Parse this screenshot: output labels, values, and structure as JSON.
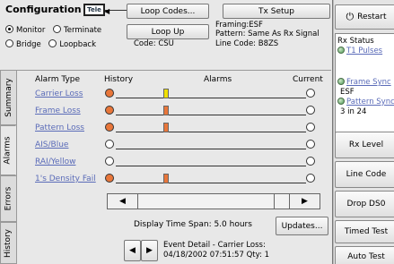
{
  "header": {
    "title": "Configuration",
    "tele_icon_label": "Tele",
    "loop_codes_button": "Loop Codes...",
    "tx_setup_button": "Tx Setup",
    "loop_up_button": "Loop Up"
  },
  "mode": {
    "monitor": "Monitor",
    "terminate": "Terminate",
    "bridge": "Bridge",
    "loopback": "Loopback",
    "selected": "Monitor"
  },
  "line_info": {
    "code": "Code: CSU",
    "framing": "Framing:ESF",
    "pattern": "Pattern: Same As Rx Signal",
    "line_code": "Line Code: B8ZS"
  },
  "tabs": [
    "Summary",
    "Alarms",
    "Errors",
    "History"
  ],
  "active_tab": "Alarms",
  "alarms": {
    "col_type": "Alarm Type",
    "col_history": "History",
    "col_alarms": "Alarms",
    "col_current": "Current",
    "rows": [
      {
        "name": "Carrier Loss",
        "history_color": "#e8763a",
        "bar_color": "#f0e000",
        "current": "off"
      },
      {
        "name": "Frame Loss",
        "history_color": "#e8763a",
        "bar_color": "#e8763a",
        "current": "off"
      },
      {
        "name": "Pattern Loss",
        "history_color": "#e8763a",
        "bar_color": "#e8763a",
        "current": "off"
      },
      {
        "name": "AIS/Blue",
        "history_color": "#ffffff",
        "bar_color": null,
        "current": "off"
      },
      {
        "name": "RAI/Yellow",
        "history_color": "#ffffff",
        "bar_color": null,
        "current": "off"
      },
      {
        "name": "1's Density Fail",
        "history_color": "#e8763a",
        "bar_color": "#e8763a",
        "current": "off"
      }
    ]
  },
  "time_span": "Display Time Span: 5.0 hours",
  "updates_button": "Updates...",
  "event_detail": {
    "line1": "Event Detail - Carrier Loss:",
    "line2": "04/18/2002  07:51:57 Qty: 1"
  },
  "sidebar": {
    "restart": "Restart",
    "rx_status_title": "Rx Status",
    "t1_pulses": "T1 Pulses",
    "frame_sync": "Frame Sync",
    "esf": "ESF",
    "pattern_sync": "Pattern Sync",
    "pattern_value": "3 in 24",
    "rx_level": "Rx Level",
    "line_code": "Line Code",
    "drop_ds0": "Drop DS0",
    "timed_test": "Timed Test",
    "auto_test": "Auto Test"
  },
  "colors": {
    "accent_link": "#5a6bb8",
    "history_orange": "#e8763a",
    "carrier_yellow": "#f0e000",
    "led_green": "#4c9a55"
  }
}
